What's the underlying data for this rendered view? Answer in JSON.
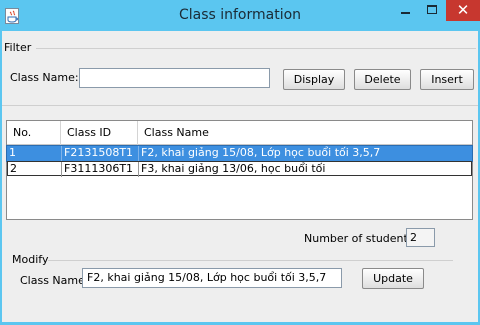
{
  "window": {
    "title": "Class information",
    "close_glyph": "✕",
    "colors": {
      "frame": "#5bc6f0",
      "close": "#c7372f",
      "selection": "#3d8fe0"
    }
  },
  "filter": {
    "group_label": "Filter",
    "class_name_label": "Class Name:",
    "class_name_value": "",
    "display_label": "Display",
    "delete_label": "Delete",
    "insert_label": "Insert"
  },
  "table": {
    "columns": [
      "No.",
      "Class ID",
      "Class Name"
    ],
    "rows": [
      {
        "no": "1",
        "class_id": "F2131508T1",
        "class_name": "F2, khai giảng 15/08, Lớp học buổi tối 3,5,7",
        "selected": true
      },
      {
        "no": "2",
        "class_id": "F3111306T1",
        "class_name": "F3, khai giảng 13/06, học buổi tối",
        "selected": false
      }
    ]
  },
  "summary": {
    "students_label": "Number of students:",
    "students_value": "2"
  },
  "modify": {
    "group_label": "Modify",
    "class_name_label": "Class Name:",
    "class_name_value": "F2, khai giảng 15/08, Lớp học buổi tối 3,5,7",
    "update_label": "Update"
  }
}
